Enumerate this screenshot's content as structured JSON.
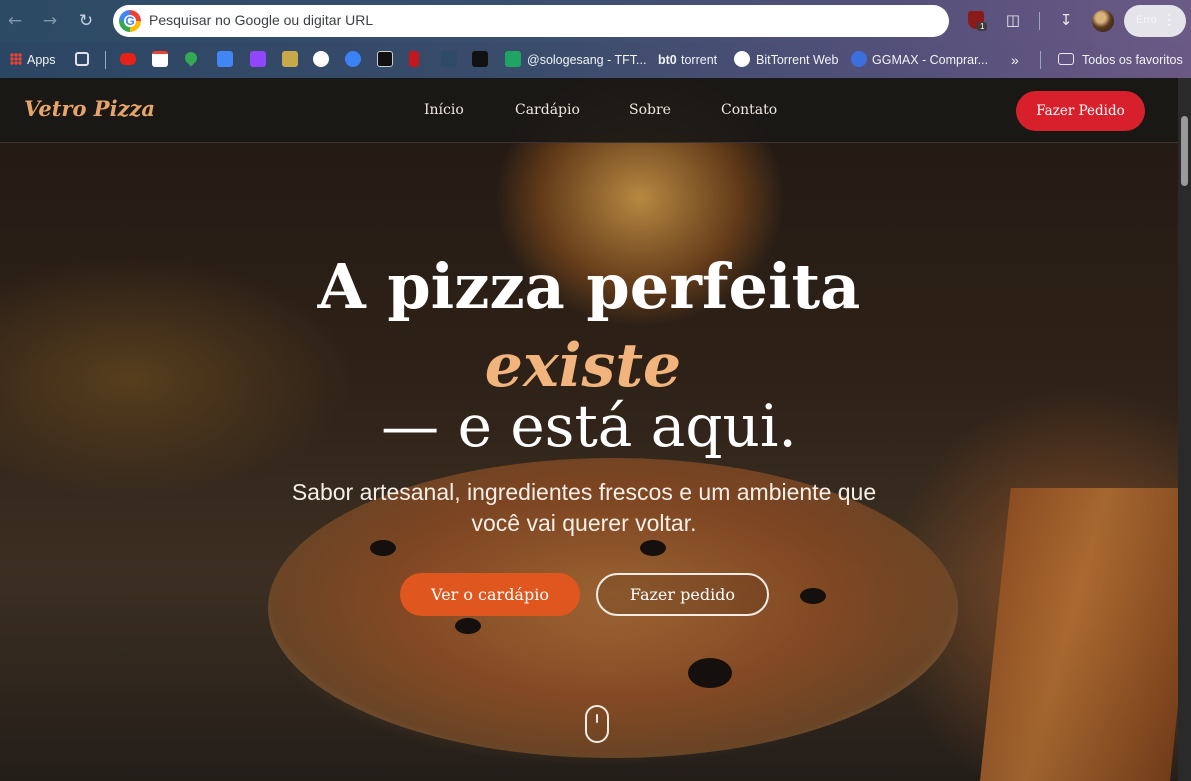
{
  "browser": {
    "omnibox_placeholder": "Pesquisar no Google ou digitar URL",
    "google_glyph": "G",
    "profile_label": "Erro",
    "extension_badge": "1",
    "bookmarks": [
      {
        "label": "Apps"
      },
      {
        "label": "@sologesang - TFT..."
      },
      {
        "label": "torrent"
      },
      {
        "label": "BitTorrent Web"
      },
      {
        "label": "GGMAX - Comprar..."
      },
      {
        "label": "Todos os favoritos"
      }
    ]
  },
  "site": {
    "brand": "Vetro Pizza",
    "nav": [
      "Início",
      "Cardápio",
      "Sobre",
      "Contato"
    ],
    "order_button": "Fazer Pedido",
    "hero": {
      "line1": "A pizza perfeita",
      "line2": "existe",
      "line3": "— e está aqui.",
      "subtitle_line1": "Sabor artesanal, ingredientes frescos e um ambiente que",
      "subtitle_line2": "você vai querer voltar.",
      "cta_primary": "Ver o cardápio",
      "cta_secondary": "Fazer pedido"
    }
  },
  "colors": {
    "brand": "#e7a56b",
    "accent_red": "#d8202c",
    "accent_orange": "#e0561f",
    "highlight": "#f1b47c"
  }
}
